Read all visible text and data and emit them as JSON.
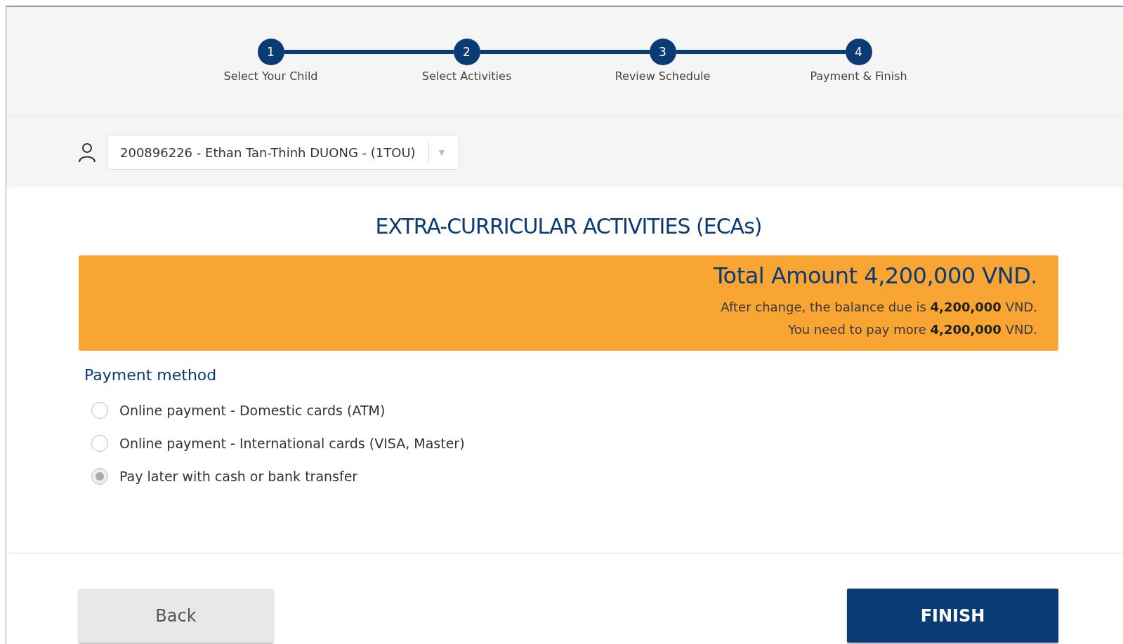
{
  "steps": [
    {
      "number": "1",
      "label": "Select Your Child",
      "completed": true
    },
    {
      "number": "2",
      "label": "Select Activities",
      "completed": true
    },
    {
      "number": "3",
      "label": "Review Schedule",
      "completed": true
    },
    {
      "number": "4",
      "label": "Payment & Finish",
      "completed": true
    }
  ],
  "student_select": {
    "value": "200896226 - Ethan Tan-Thinh DUONG - (1TOU)",
    "caret": "▼"
  },
  "title": "EXTRA-CURRICULAR ACTIVITIES (ECAs)",
  "summary": {
    "total": "Total Amount 4,200,000 VND.",
    "lines": [
      "After change, the balance due is **4,200,000** VND.",
      "You need to pay more **4,200,000** VND."
    ]
  },
  "payment_method": {
    "heading": "Payment method",
    "options": [
      {
        "label": "Online payment - Domestic cards (ATM)",
        "selected": false
      },
      {
        "label": "Online payment - International cards (VISA, Master)",
        "selected": false
      },
      {
        "label": "Pay later with cash or bank transfer",
        "selected": true
      }
    ]
  },
  "buttons": {
    "back": "Back",
    "finish": "FINISH"
  }
}
